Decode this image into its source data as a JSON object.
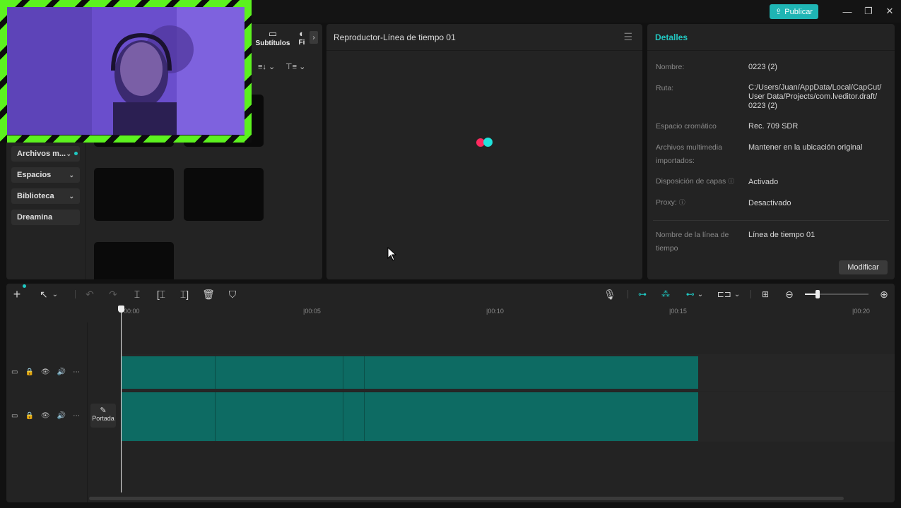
{
  "window": {
    "publish_label": "Publicar"
  },
  "left_panel": {
    "tabs": [
      {
        "label": "Subtítulos",
        "icon": "subtitles-icon"
      },
      {
        "label": "Fi",
        "icon": "filters-icon"
      }
    ],
    "sidebar": [
      {
        "label": "Archivos m...",
        "has_dot": true
      },
      {
        "label": "Espacios"
      },
      {
        "label": "Biblioteca"
      },
      {
        "label": "Dreamina"
      }
    ]
  },
  "player": {
    "title": "Reproductor-Línea de tiempo 01"
  },
  "details": {
    "title": "Detalles",
    "rows": [
      {
        "label": "Nombre:",
        "value": "0223 (2)"
      },
      {
        "label": "Ruta:",
        "value": "C:/Users/Juan/AppData/Local/CapCut/ User Data/Projects/com.lveditor.draft/ 0223 (2)"
      },
      {
        "label": "Espacio cromático",
        "value": "Rec. 709 SDR"
      },
      {
        "label": "Archivos multimedia importados:",
        "value": "Mantener en la ubicación original"
      },
      {
        "label": "Disposición de capas",
        "value": "Activado"
      },
      {
        "label": "Proxy:",
        "value": "Desactivado"
      },
      {
        "label": "Nombre de la línea de tiempo",
        "value": "Línea de tiempo 01"
      }
    ],
    "modify_label": "Modificar"
  },
  "timeline": {
    "ruler": [
      "00:00",
      "|00:05",
      "|00:10",
      "|00:15",
      "|00:20"
    ],
    "cover_label": "Portada"
  },
  "colors": {
    "accent": "#1fb5b4",
    "clip": "#0d6b63",
    "panel": "#232323"
  }
}
